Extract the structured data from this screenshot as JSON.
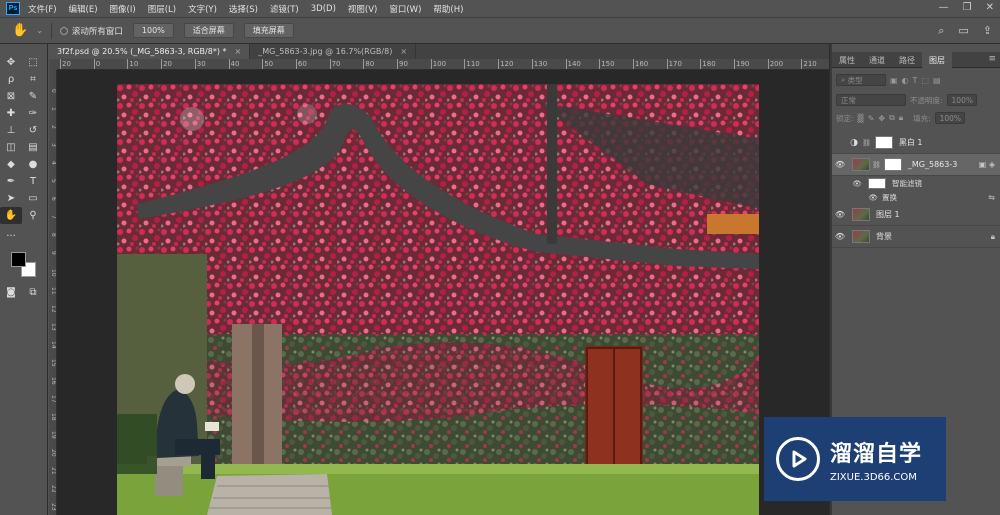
{
  "app": {
    "logo": "Ps"
  },
  "menu": [
    "文件(F)",
    "编辑(E)",
    "图像(I)",
    "图层(L)",
    "文字(Y)",
    "选择(S)",
    "滤镜(T)",
    "3D(D)",
    "视图(V)",
    "窗口(W)",
    "帮助(H)"
  ],
  "options": {
    "scroll_all": "滚动所有窗口",
    "zoom": "100%",
    "fit_screen": "适合屏幕",
    "fill_screen": "填充屏幕"
  },
  "tabs": [
    {
      "label": "3f2f.psd @ 20.5% (_MG_5863-3, RGB/8*) *",
      "close": "×"
    },
    {
      "label": "_MG_5863-3.jpg @ 16.7%(RGB/8)",
      "close": "×"
    }
  ],
  "ruler_h": [
    "20",
    "0",
    "10",
    "20",
    "30",
    "40",
    "50",
    "60",
    "70",
    "80",
    "90",
    "100",
    "110",
    "120",
    "130",
    "140",
    "150",
    "160",
    "170",
    "180",
    "190",
    "200",
    "210",
    "220"
  ],
  "ruler_v": [
    "0",
    "1",
    "2",
    "3",
    "4",
    "5",
    "6",
    "7",
    "8",
    "9",
    "10",
    "11",
    "12",
    "13",
    "14",
    "15",
    "16",
    "17",
    "18",
    "19",
    "20",
    "21",
    "22",
    "23",
    "24"
  ],
  "panel": {
    "tabs": [
      "属性",
      "通道",
      "路径",
      "图层"
    ],
    "filter_kind": "类型",
    "blend_mode": "正常",
    "opacity_label": "不透明度:",
    "opacity": "100%",
    "lock_label": "锁定:",
    "fill_label": "填充:",
    "fill": "100%"
  },
  "layers": [
    {
      "name": "黑白 1",
      "type": "adjustment"
    },
    {
      "name": "_MG_5863-3",
      "type": "smart",
      "selected": true
    },
    {
      "name": "智能滤镜",
      "type": "sub"
    },
    {
      "name": "置换",
      "type": "sub2"
    },
    {
      "name": "图层 1",
      "type": "photo"
    },
    {
      "name": "背景",
      "type": "photo"
    }
  ],
  "watermark": {
    "cn": "溜溜自学",
    "url": "ZIXUE.3D66.COM"
  }
}
